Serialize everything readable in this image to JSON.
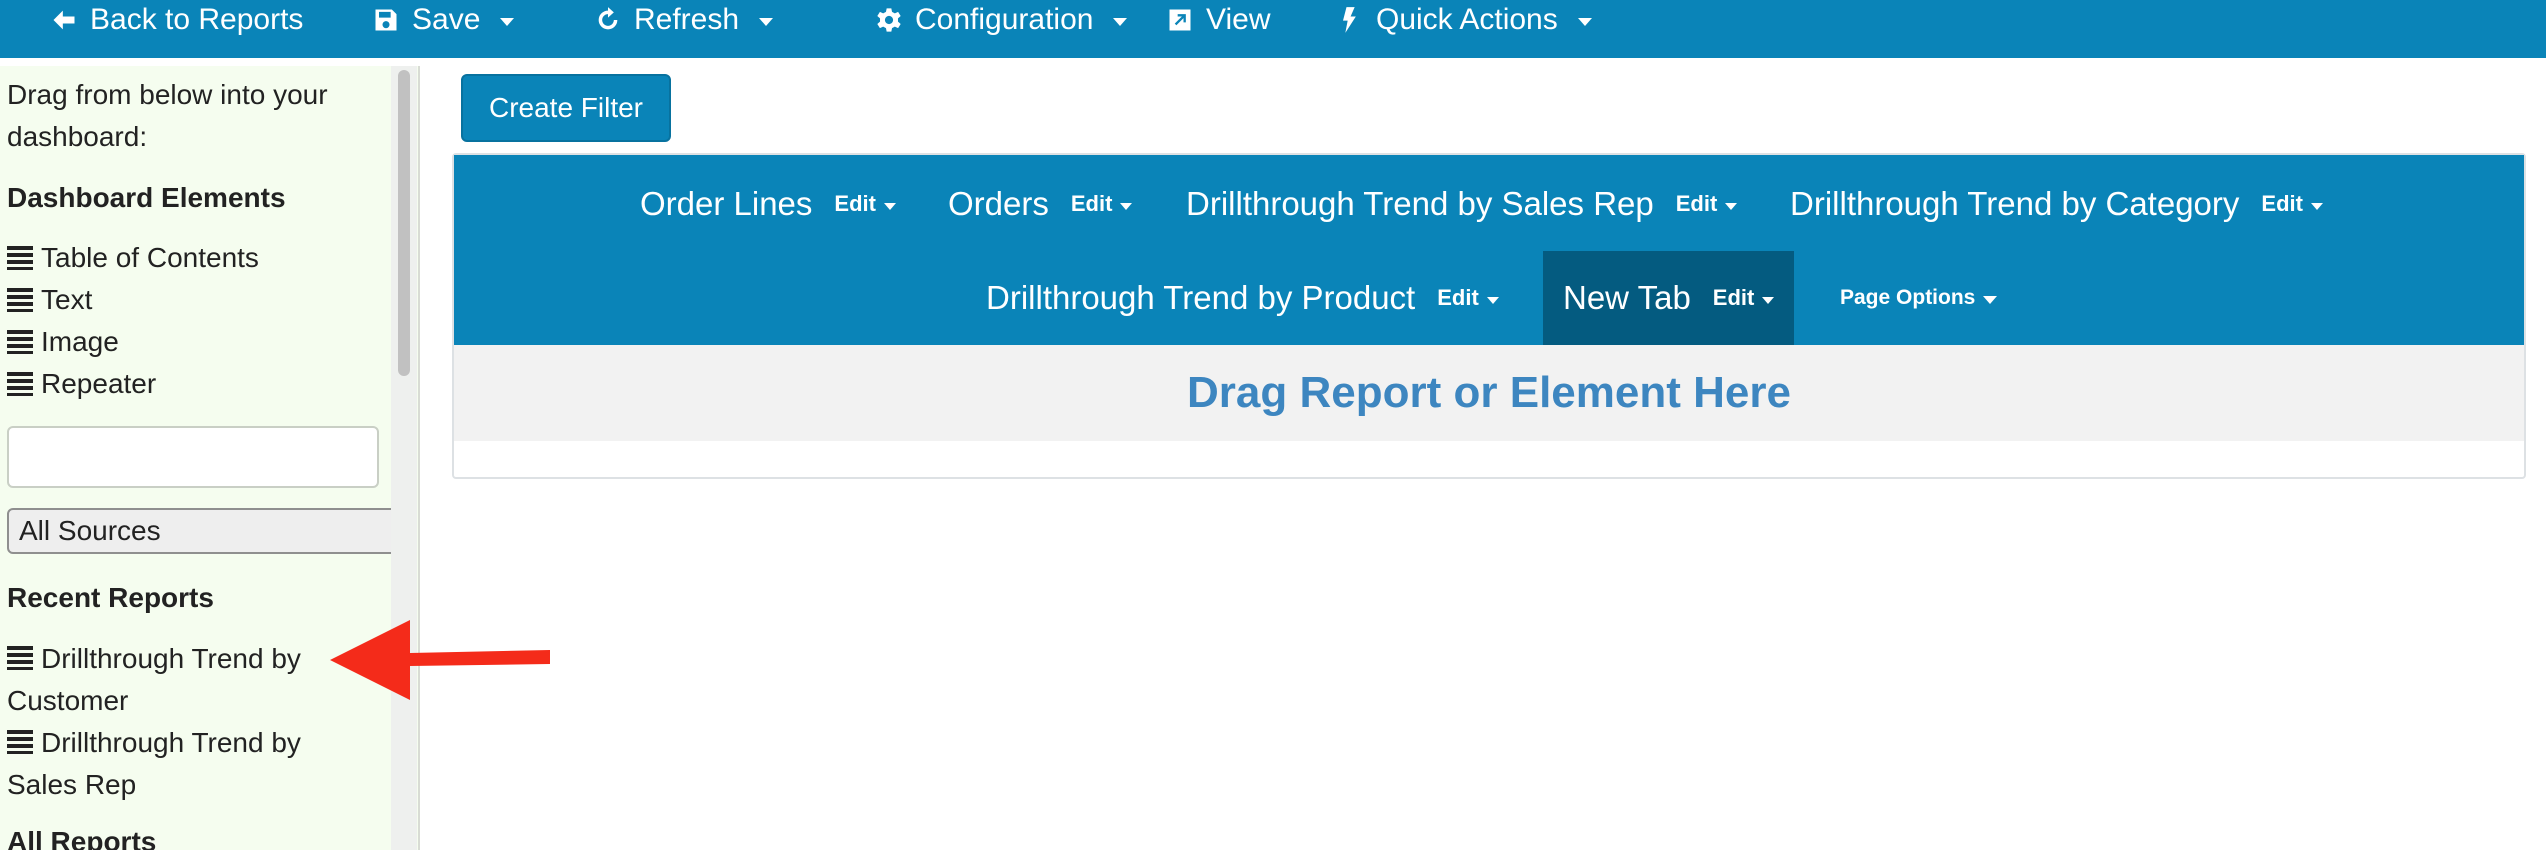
{
  "toolbar": {
    "back_label": "Back to Reports",
    "save_label": "Save",
    "refresh_label": "Refresh",
    "configuration_label": "Configuration",
    "view_label": "View",
    "quick_actions_label": "Quick Actions"
  },
  "sidebar": {
    "instructions_line1": "Drag from below into your",
    "instructions_line2": "dashboard:",
    "elements_heading": "Dashboard Elements",
    "elements": [
      {
        "label": "Table of Contents",
        "icon": "list-icon"
      },
      {
        "label": "Text",
        "icon": "list-icon"
      },
      {
        "label": "Image",
        "icon": "list-icon"
      },
      {
        "label": "Repeater",
        "icon": "list-icon"
      }
    ],
    "search_value": "",
    "source_select": "All Sources",
    "recent_heading": "Recent Reports",
    "recent_reports": [
      {
        "line1": "Drillthrough Trend by",
        "line2": "Customer"
      },
      {
        "line1": "Drillthrough Trend by",
        "line2": "Sales Rep"
      }
    ],
    "all_heading": "All Reports"
  },
  "main": {
    "create_filter_label": "Create Filter",
    "tabs": [
      {
        "label": "Order Lines",
        "edit": "Edit"
      },
      {
        "label": "Orders",
        "edit": "Edit"
      },
      {
        "label": "Drillthrough Trend by Sales Rep",
        "edit": "Edit"
      },
      {
        "label": "Drillthrough Trend by Category",
        "edit": "Edit"
      },
      {
        "label": "Drillthrough Trend by Product",
        "edit": "Edit"
      },
      {
        "label": "New Tab",
        "edit": "Edit",
        "active": true
      }
    ],
    "page_options_label": "Page Options",
    "dropzone_text": "Drag Report or Element Here"
  },
  "colors": {
    "brand_blue": "#0a84b8",
    "active_tab": "#045b80",
    "sidebar_bg": "#f5fdef",
    "dropzone_text": "#3d86c0",
    "arrow": "#f42b1a"
  }
}
